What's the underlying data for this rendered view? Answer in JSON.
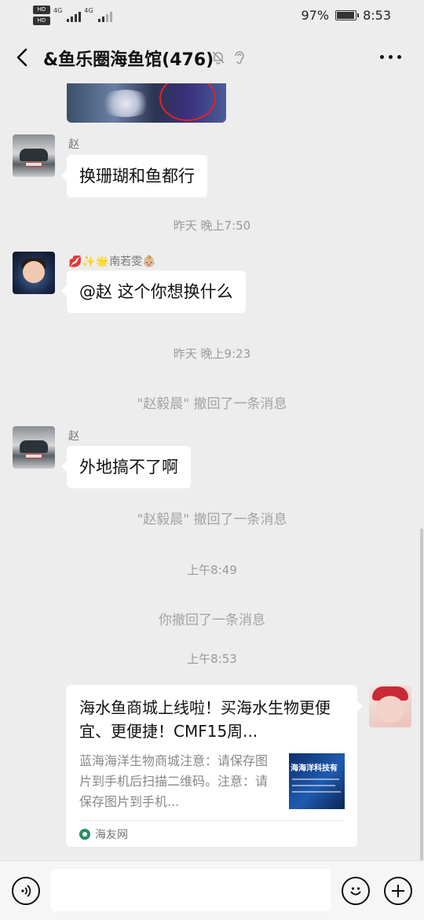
{
  "status_bar": {
    "hd_badge_1": "HD",
    "hd_badge_2": "HD",
    "network": "4G",
    "battery_percent": "97%",
    "battery_level": 0.97,
    "time": "8:53"
  },
  "header": {
    "title": "&鱼乐圈海鱼馆(476)",
    "back_icon": "chevron-left-icon",
    "mute_icon": "bell-off-icon",
    "ear_icon": "ear-icon",
    "more_icon": "more-horizontal-icon"
  },
  "messages": [
    {
      "type": "image",
      "sender": "",
      "avatar": "car-avatar"
    },
    {
      "type": "text",
      "sender": "赵",
      "avatar": "car-avatar",
      "text": "换珊瑚和鱼都行"
    },
    {
      "type": "time",
      "text": "昨天 晚上7:50"
    },
    {
      "type": "text",
      "sender": "💋✨🌟南若雯👶🏼",
      "avatar": "doll-avatar",
      "text": "@赵  这个你想换什么"
    },
    {
      "type": "time",
      "text": "昨天 晚上9:23"
    },
    {
      "type": "system",
      "text": "\"赵毅晨\" 撤回了一条消息"
    },
    {
      "type": "text",
      "sender": "赵",
      "avatar": "car-avatar",
      "text": "外地搞不了啊"
    },
    {
      "type": "system",
      "text": "\"赵毅晨\" 撤回了一条消息"
    },
    {
      "type": "time",
      "text": "上午8:49"
    },
    {
      "type": "system",
      "text": "你撤回了一条消息"
    },
    {
      "type": "time",
      "text": "上午8:53"
    }
  ],
  "link_card": {
    "title": "海水鱼商城上线啦！买海水生物更便宜、更便捷！CMF15周...",
    "description": "蓝海海洋生物商城注意：请保存图片到手机后扫描二维码。注意：请保存图片到手机...",
    "thumbnail_text": "海海洋科技有",
    "source": "海友网",
    "avatar": "baby-avatar"
  },
  "input_bar": {
    "voice_icon": "voice-icon",
    "emoji_icon": "emoji-icon",
    "plus_icon": "plus-icon",
    "placeholder": ""
  }
}
